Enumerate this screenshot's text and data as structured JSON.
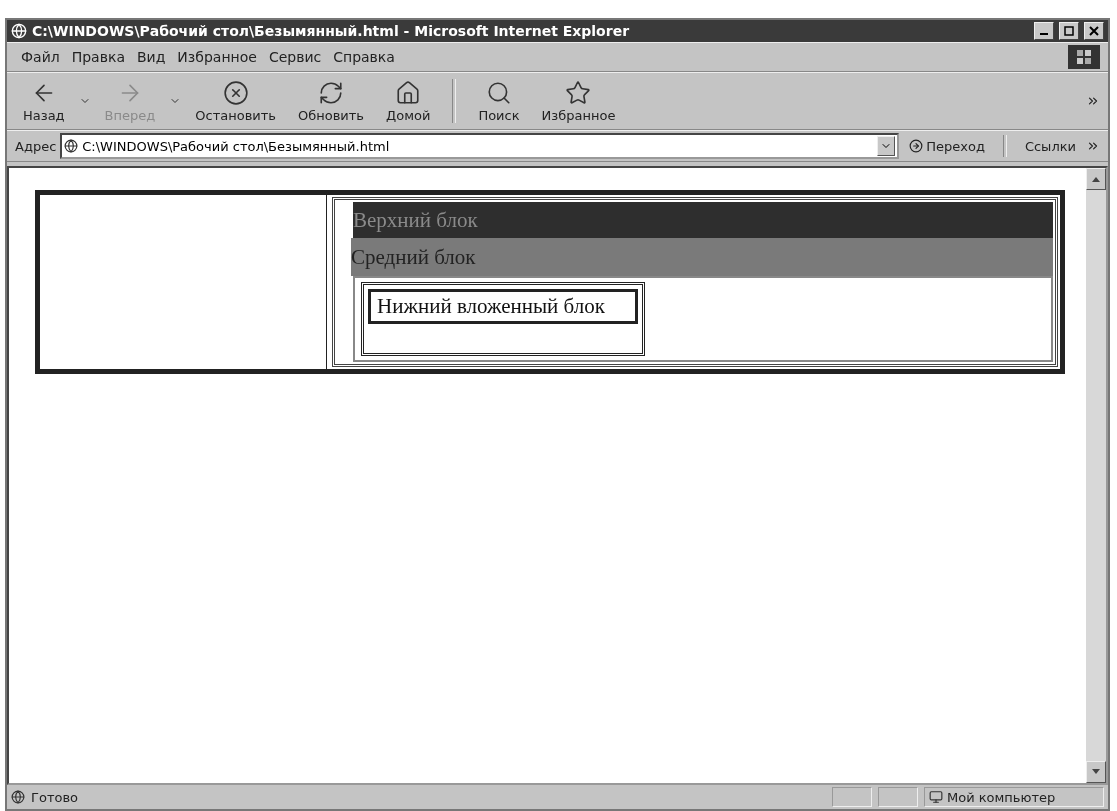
{
  "window": {
    "title": "C:\\WINDOWS\\Рабочий стол\\Безымянный.html - Microsoft Internet Explorer"
  },
  "menu": [
    "Файл",
    "Правка",
    "Вид",
    "Избранное",
    "Сервис",
    "Справка"
  ],
  "toolbar": [
    {
      "kind": "back",
      "label": "Назад",
      "disabled": false,
      "dropdown": true
    },
    {
      "kind": "forward",
      "label": "Вперед",
      "disabled": true,
      "dropdown": true
    },
    {
      "kind": "stop",
      "label": "Остановить",
      "disabled": false,
      "dropdown": false
    },
    {
      "kind": "refresh",
      "label": "Обновить",
      "disabled": false,
      "dropdown": false
    },
    {
      "kind": "home",
      "label": "Домой",
      "disabled": false,
      "dropdown": false
    },
    {
      "kind": "search",
      "label": "Поиск",
      "disabled": false,
      "dropdown": false
    },
    {
      "kind": "favorites",
      "label": "Избранное",
      "disabled": false,
      "dropdown": false
    }
  ],
  "address_bar": {
    "label": "Адрес",
    "value": "C:\\WINDOWS\\Рабочий стол\\Безымянный.html",
    "go": "Переход",
    "links": "Ссылки"
  },
  "page": {
    "top_block": "Верхний блок",
    "middle_block": "Средний блок",
    "bottom_block": "Нижний вложенный блок"
  },
  "status_bar": {
    "text": "Готово",
    "zone": "Мой компьютер"
  }
}
